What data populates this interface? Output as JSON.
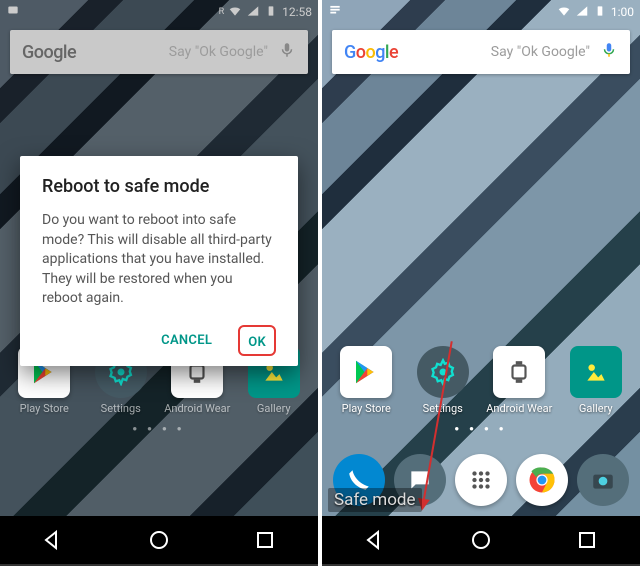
{
  "left": {
    "status": {
      "time": "12:58"
    },
    "search": {
      "hint": "Say \"Ok Google\""
    },
    "dialog": {
      "title": "Reboot to safe mode",
      "body": "Do you want to reboot into safe mode? This will disable all third-party applications that you have installed. They will be restored when you reboot again.",
      "cancel": "CANCEL",
      "ok": "OK"
    },
    "apps": [
      {
        "label": "Play Store"
      },
      {
        "label": "Settings"
      },
      {
        "label": "Android Wear"
      },
      {
        "label": "Gallery"
      }
    ]
  },
  "right": {
    "status": {
      "time": "1:00"
    },
    "search": {
      "hint": "Say \"Ok Google\""
    },
    "safemode_label": "Safe mode",
    "apps": [
      {
        "label": "Play Store"
      },
      {
        "label": "Settings"
      },
      {
        "label": "Android Wear"
      },
      {
        "label": "Gallery"
      }
    ]
  },
  "colors": {
    "teal": "#009688",
    "red": "#e53935"
  }
}
